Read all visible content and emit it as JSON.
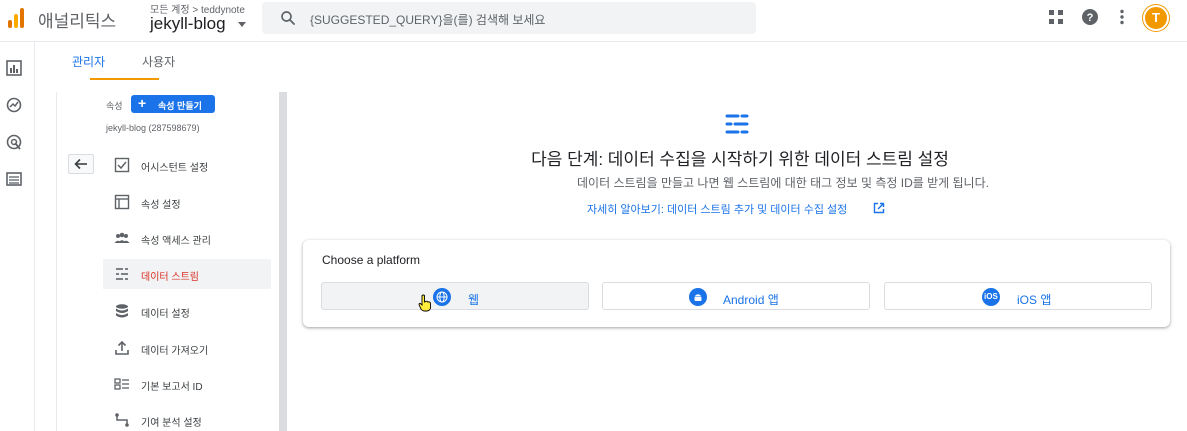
{
  "topbar": {
    "app_title": "애널리틱스",
    "account_breadcrumb": "모든 계정 > teddynote",
    "account_name": "jekyll-blog",
    "search_placeholder": "{SUGGESTED_QUERY}을(를) 검색해 보세요",
    "icons": [
      "analytics-logo",
      "search-icon",
      "apps-grid-icon",
      "help-icon",
      "more-vert-icon",
      "avatar"
    ]
  },
  "rail": {
    "icons": [
      "reports-icon",
      "explore-icon",
      "advertising-icon",
      "configure-icon"
    ]
  },
  "tabs": [
    {
      "label": "관리자",
      "active": true
    },
    {
      "label": "사용자",
      "active": false
    }
  ],
  "property": {
    "label": "속성",
    "create_button": "속성 만들기",
    "name": "jekyll-blog (287598679)"
  },
  "nav": [
    {
      "label": "어시스턴트 설정",
      "icon": "checklist-icon",
      "active": false
    },
    {
      "label": "속성 설정",
      "icon": "property-icon",
      "active": false
    },
    {
      "label": "속성 액세스 관리",
      "icon": "people-icon",
      "active": false
    },
    {
      "label": "데이터 스트림",
      "icon": "data-stream-icon",
      "active": true
    },
    {
      "label": "데이터 설정",
      "icon": "database-icon",
      "active": false
    },
    {
      "label": "데이터 가져오기",
      "icon": "upload-icon",
      "active": false
    },
    {
      "label": "기본 보고서 ID",
      "icon": "report-id-icon",
      "active": false
    },
    {
      "label": "기여 분석 설정",
      "icon": "attribution-icon",
      "active": false
    }
  ],
  "main": {
    "title": "다음 단계: 데이터 수집을 시작하기 위한 데이터 스트림 설정",
    "description": "데이터 스트림을 만들고 나면 웹 스트림에 대한 태그 정보 및 측정 ID를 받게 됩니다.",
    "learn_more": "자세히 알아보기: 데이터 스트림 추가 및 데이터 수집 설정",
    "platform_title": "Choose a platform",
    "platforms": [
      {
        "label": "웹",
        "icon": "globe-icon"
      },
      {
        "label": "Android 앱",
        "icon": "android-icon"
      },
      {
        "label": "iOS 앱",
        "icon": "ios-icon",
        "badge": "iOS"
      }
    ]
  },
  "colors": {
    "accent": "#1a73e8",
    "brand": "#f29900",
    "active_nav": "#d93025"
  }
}
